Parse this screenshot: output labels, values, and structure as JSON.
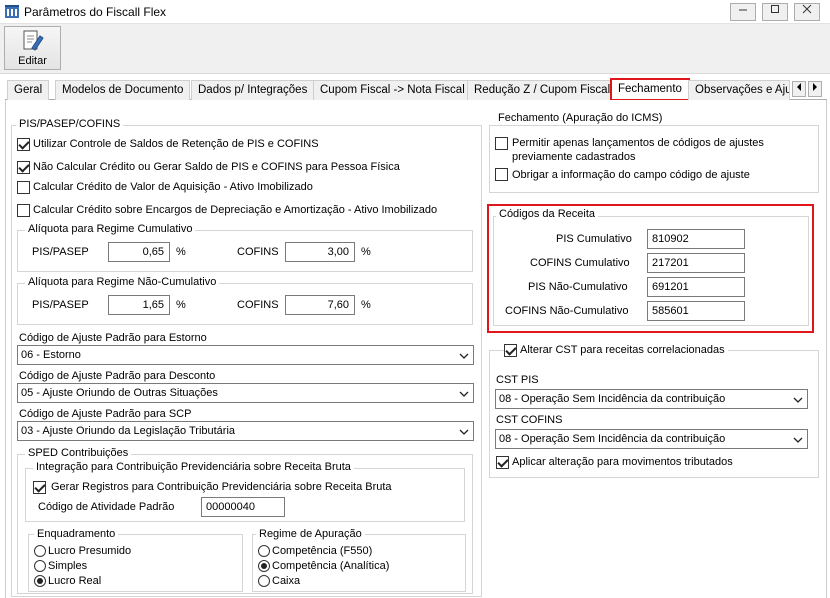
{
  "window": {
    "title": "Parâmetros do Fiscall Flex"
  },
  "toolbar": {
    "edit_label": "Editar"
  },
  "tabs": [
    "Geral",
    "Modelos de Documento",
    "Dados p/ Integrações",
    "Cupom Fiscal -> Nota Fiscal",
    "Redução Z / Cupom Fiscal",
    "Fechamento",
    "Observações e Ajus"
  ],
  "active_tab": "Fechamento",
  "pis": {
    "group_title": "PIS/PASEP/COFINS",
    "checks": [
      {
        "label": "Utilizar Controle de Saldos de Retenção de PIS e COFINS",
        "checked": true
      },
      {
        "label": "Não Calcular Crédito ou Gerar Saldo de PIS e COFINS para Pessoa Física",
        "checked": true
      },
      {
        "label": "Calcular Crédito de Valor de Aquisição - Ativo Imobilizado",
        "checked": false
      },
      {
        "label": "Calcular Crédito sobre Encargos de Depreciação e Amortização - Ativo Imobilizado",
        "checked": false
      }
    ],
    "cumulativo": {
      "title": "Alíquota para Regime Cumulativo",
      "pis_label": "PIS/PASEP",
      "pis_value": "0,65",
      "cofins_label": "COFINS",
      "cofins_value": "3,00",
      "pct": "%"
    },
    "nao_cumulativo": {
      "title": "Alíquota para Regime Não-Cumulativo",
      "pis_label": "PIS/PASEP",
      "pis_value": "1,65",
      "cofins_label": "COFINS",
      "cofins_value": "7,60",
      "pct": "%"
    },
    "estorno": {
      "label": "Código de Ajuste Padrão para Estorno",
      "value": "06 - Estorno"
    },
    "desconto": {
      "label": "Código de Ajuste Padrão para Desconto",
      "value": "05 - Ajuste Oriundo de Outras Situações"
    },
    "scp": {
      "label": "Código de Ajuste Padrão para SCP",
      "value": "03 - Ajuste Oriundo da Legislação Tributária"
    }
  },
  "sped": {
    "title": "SPED Contribuições",
    "integracao": {
      "title": "Integração para Contribuição Previdenciária sobre Receita Bruta",
      "check_label": "Gerar Registros para Contribuição Previdenciária sobre Receita Bruta",
      "checked": true,
      "atividade_label": "Código de Atividade Padrão",
      "atividade_value": "00000040"
    },
    "enquadramento": {
      "title": "Enquadramento",
      "options": [
        "Lucro Presumido",
        "Simples",
        "Lucro Real"
      ],
      "selected": "Lucro Real"
    },
    "regime": {
      "title": "Regime de Apuração",
      "options": [
        "Competência (F550)",
        "Competência (Analítica)",
        "Caixa"
      ],
      "selected": "Competência (Analítica)"
    }
  },
  "fechamento": {
    "title": "Fechamento (Apuração do ICMS)",
    "check1_line1": "Permitir apenas lançamentos de códigos de ajustes",
    "check1_line2": "previamente cadastrados",
    "check1_checked": false,
    "check2_label": "Obrigar a informação do campo código de ajuste",
    "check2_checked": false
  },
  "codigos": {
    "title": "Códigos da Receita",
    "rows": [
      {
        "label": "PIS Cumulativo",
        "value": "810902"
      },
      {
        "label": "COFINS Cumulativo",
        "value": "217201"
      },
      {
        "label": "PIS Não-Cumulativo",
        "value": "691201"
      },
      {
        "label": "COFINS Não-Cumulativo",
        "value": "585601"
      }
    ]
  },
  "cst": {
    "alterar_label": "Alterar CST para receitas correlacionadas",
    "alterar_checked": true,
    "cst_pis_label": "CST PIS",
    "cst_pis_value": "08 - Operação Sem Incidência da contribuição",
    "cst_cofins_label": "CST COFINS",
    "cst_cofins_value": "08 - Operação Sem Incidência da contribuição",
    "aplicar_label": "Aplicar alteração para movimentos tributados",
    "aplicar_checked": true
  },
  "colors": {
    "highlight": "#e0161b",
    "border": "#d5d5d5"
  }
}
